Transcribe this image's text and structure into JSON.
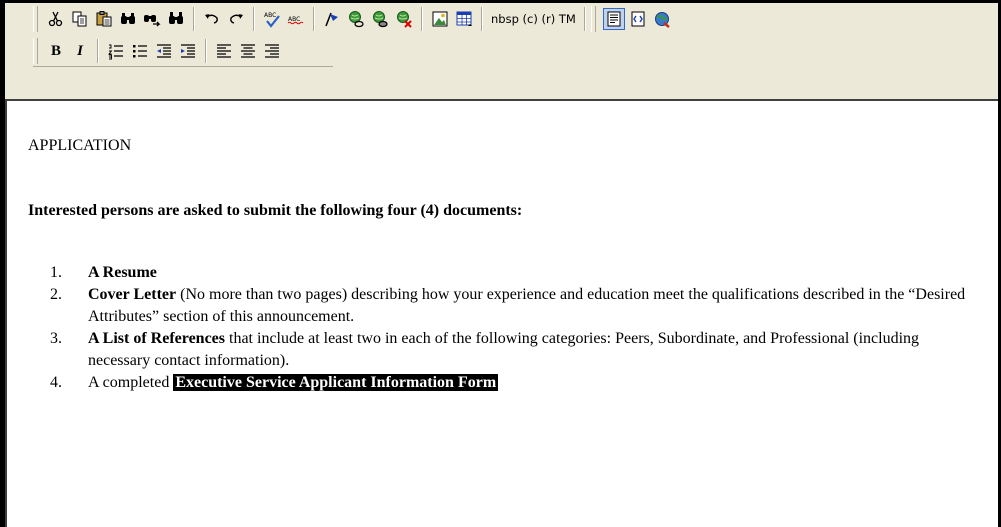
{
  "toolbar": {
    "row1": {
      "buttons": [
        {
          "name": "cut-icon"
        },
        {
          "name": "copy-icon"
        },
        {
          "name": "paste-icon"
        },
        {
          "name": "find-icon"
        },
        {
          "name": "find-next-icon"
        },
        {
          "name": "replace-icon"
        },
        {
          "name": "undo-icon"
        },
        {
          "name": "redo-icon"
        },
        {
          "name": "spellcheck-icon"
        },
        {
          "name": "spellcheck-inline-icon"
        },
        {
          "name": "bookmark-flag-icon"
        },
        {
          "name": "insert-link-icon"
        },
        {
          "name": "edit-link-icon"
        },
        {
          "name": "remove-link-icon"
        },
        {
          "name": "insert-image-icon"
        },
        {
          "name": "insert-table-icon"
        }
      ],
      "special_chars": "nbsp (c) (r) TM",
      "view_buttons": [
        {
          "name": "design-view-icon",
          "active": true
        },
        {
          "name": "html-view-icon",
          "active": false
        },
        {
          "name": "preview-icon",
          "active": false
        }
      ]
    },
    "row2": {
      "bold_label": "B",
      "italic_label": "I"
    }
  },
  "document": {
    "heading": "APPLICATION",
    "intro": "Interested persons are asked to submit the following four (4) documents:",
    "items": [
      {
        "num": "1.",
        "bold": "A Resume",
        "rest": ""
      },
      {
        "num": "2.",
        "bold": "Cover Letter",
        "rest": " (No more than two pages) describing how your experience and education meet the qualifications described in the “Desired Attributes” section of this announcement."
      },
      {
        "num": "3.",
        "bold": "A List of References",
        "rest": " that include at least two in each of the following categories: Peers, Subordinate, and Professional (including necessary contact information)."
      },
      {
        "num": "4.",
        "prefix": "A completed ",
        "highlight": "Executive Service Applicant Information Form"
      }
    ]
  }
}
